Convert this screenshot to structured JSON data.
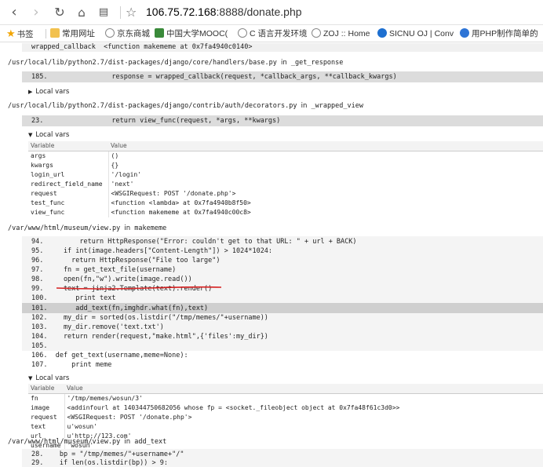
{
  "browser": {
    "url_host": "106.75.72.168",
    "url_rest": ":8888/donate.php",
    "bookmarks": [
      {
        "label": "书签",
        "icon": "star-icon"
      },
      {
        "label": "常用网址",
        "icon": "folder-icon"
      },
      {
        "label": "京东商城",
        "icon": "globe-icon"
      },
      {
        "label": "中国大学MOOC(",
        "icon": "flag-icon"
      },
      {
        "label": "C 语言开发环境",
        "icon": "globe-icon"
      },
      {
        "label": "ZOJ :: Home",
        "icon": "globe-icon"
      },
      {
        "label": "SICNU OJ | Conv",
        "icon": "shield-icon"
      },
      {
        "label": "用PHP制作简单的",
        "icon": "paw-icon"
      }
    ]
  },
  "trace": {
    "top_line": "wrapped_callback  <function makememe at 0x7fa4940c0140>",
    "frames": [
      {
        "file": "/usr/local/lib/python2.7/dist-packages/django/core/handlers/base.py",
        "in": "in",
        "func": "_get_response",
        "context_line": "185.                response = wrapped_callback(request, *callback_args, **callback_kwargs)",
        "local_vars_label": "Local vars"
      },
      {
        "file": "/usr/local/lib/python2.7/dist-packages/django/contrib/auth/decorators.py",
        "in": "in",
        "func": "_wrapped_view",
        "context_line": "23.                 return view_func(request, *args, **kwargs)",
        "local_vars_label": "Local vars",
        "vars_header": [
          "Variable",
          "Value"
        ],
        "vars": [
          [
            "args",
            "()"
          ],
          [
            "kwargs",
            "{}"
          ],
          [
            "login_url",
            "'/login'"
          ],
          [
            "redirect_field_name",
            "'next'"
          ],
          [
            "request",
            "<WSGIRequest: POST '/donate.php'>"
          ],
          [
            "test_func",
            "<function <lambda> at 0x7fa4940b8f50>"
          ],
          [
            "view_func",
            "<function makememe at 0x7fa4940c00c8>"
          ]
        ]
      },
      {
        "file": "/var/www/html/museum/view.py",
        "in": "in",
        "func": "makememe",
        "code": [
          "94.         return HttpResponse(\"Error: couldn't get to that URL: \" + url + BACK)",
          "95.     if int(image.headers[\"Content-Length\"]) > 1024*1024:",
          "96.       return HttpResponse(\"File too large\")",
          "97.     fn = get_text_file(username)",
          "98.     open(fn,\"w\").write(image.read())",
          "99.     text = jinja2.Template(text).render()",
          "100.       print text"
        ],
        "current_line": "101.       add_text(fn,imghdr.what(fn),text)",
        "code_after": [
          "102.    my_dir = sorted(os.listdir(\"/tmp/memes/\"+username))",
          "103.    my_dir.remove('text.txt')",
          "104.    return render(request,\"make.html\",{'files':my_dir})",
          "105.",
          "106.  def get_text(username,meme=None):",
          "107.      print meme"
        ],
        "local_vars_label": "Local vars",
        "vars_header": [
          "Variable",
          "Value"
        ],
        "vars": [
          [
            "fn",
            "'/tmp/memes/wosun/3'"
          ],
          [
            "image",
            "<addinfourl at 140344750682056 whose fp = <socket._fileobject object at 0x7fa48f61c3d0>>"
          ],
          [
            "request",
            "<WSGIRequest: POST '/donate.php'>"
          ],
          [
            "text",
            "u'wosun'"
          ],
          [
            "url",
            "u'http://123.com'"
          ],
          [
            "username",
            "'wosun'"
          ]
        ]
      },
      {
        "file": "/var/www/html/museum/view.py",
        "in": "in",
        "func": "add_text",
        "code": [
          "28.    bp = \"/tmp/memes/\"+username+\"/\"",
          "29.    if len(os.listdir(bp)) > 9:"
        ]
      }
    ]
  },
  "colors": {
    "context_bg": "#dcdcdc",
    "current_line_bg": "#cfcfcf",
    "annotation_red": "#d62020"
  }
}
